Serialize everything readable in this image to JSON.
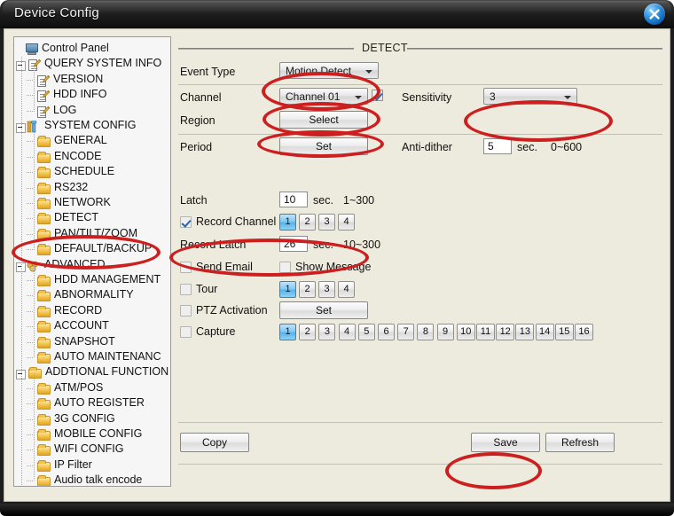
{
  "window": {
    "title": "Device Config",
    "close_icon": "close-x-icon"
  },
  "tree": {
    "items": [
      {
        "label": "Control Panel",
        "icon": "monitor-icon",
        "depth": 0,
        "expander": false
      },
      {
        "label": "QUERY SYSTEM INFO",
        "icon": "document-pencil-icon",
        "depth": 0,
        "expander": true
      },
      {
        "label": "VERSION",
        "icon": "document-pencil-icon",
        "depth": 1,
        "expander": false
      },
      {
        "label": "HDD INFO",
        "icon": "document-pencil-icon",
        "depth": 1,
        "expander": false
      },
      {
        "label": "LOG",
        "icon": "document-pencil-icon",
        "depth": 1,
        "expander": false
      },
      {
        "label": "SYSTEM CONFIG",
        "icon": "tool-icon",
        "depth": 0,
        "expander": true
      },
      {
        "label": "GENERAL",
        "icon": "folder-icon",
        "depth": 1,
        "expander": false
      },
      {
        "label": "ENCODE",
        "icon": "folder-icon",
        "depth": 1,
        "expander": false
      },
      {
        "label": "SCHEDULE",
        "icon": "folder-icon",
        "depth": 1,
        "expander": false
      },
      {
        "label": "RS232",
        "icon": "folder-icon",
        "depth": 1,
        "expander": false
      },
      {
        "label": "NETWORK",
        "icon": "folder-icon",
        "depth": 1,
        "expander": false
      },
      {
        "label": "DETECT",
        "icon": "folder-icon",
        "depth": 1,
        "expander": false
      },
      {
        "label": "PAN/TILT/ZOOM",
        "icon": "folder-icon",
        "depth": 1,
        "expander": false
      },
      {
        "label": "DEFAULT/BACKUP",
        "icon": "folder-icon",
        "depth": 1,
        "expander": false
      },
      {
        "label": "ADVANCED",
        "icon": "advanced-icon",
        "depth": 0,
        "expander": true
      },
      {
        "label": "HDD MANAGEMENT",
        "icon": "folder-icon",
        "depth": 1,
        "expander": false
      },
      {
        "label": "ABNORMALITY",
        "icon": "folder-icon",
        "depth": 1,
        "expander": false
      },
      {
        "label": "RECORD",
        "icon": "folder-icon",
        "depth": 1,
        "expander": false
      },
      {
        "label": "ACCOUNT",
        "icon": "folder-icon",
        "depth": 1,
        "expander": false
      },
      {
        "label": "SNAPSHOT",
        "icon": "folder-icon",
        "depth": 1,
        "expander": false
      },
      {
        "label": "AUTO MAINTENANC",
        "icon": "folder-icon",
        "depth": 1,
        "expander": false
      },
      {
        "label": "ADDTIONAL FUNCTION",
        "icon": "folder-icon",
        "depth": 0,
        "expander": true
      },
      {
        "label": "ATM/POS",
        "icon": "folder-icon",
        "depth": 1,
        "expander": false
      },
      {
        "label": "AUTO REGISTER",
        "icon": "folder-icon",
        "depth": 1,
        "expander": false
      },
      {
        "label": "3G CONFIG",
        "icon": "folder-icon",
        "depth": 1,
        "expander": false
      },
      {
        "label": "MOBILE CONFIG",
        "icon": "folder-icon",
        "depth": 1,
        "expander": false
      },
      {
        "label": "WIFI CONFIG",
        "icon": "folder-icon",
        "depth": 1,
        "expander": false
      },
      {
        "label": "IP Filter",
        "icon": "folder-icon",
        "depth": 1,
        "expander": false
      },
      {
        "label": "Audio talk encode",
        "icon": "folder-icon",
        "depth": 1,
        "expander": false
      }
    ]
  },
  "panel": {
    "header": "DETECT",
    "event_type": {
      "label": "Event Type",
      "value": "Motion Detect"
    },
    "channel": {
      "label": "Channel",
      "value": "Channel 01",
      "enabled_checked": true
    },
    "sensitivity": {
      "label": "Sensitivity",
      "value": "3"
    },
    "region": {
      "label": "Region",
      "button": "Select"
    },
    "period": {
      "label": "Period",
      "button": "Set"
    },
    "anti_dither": {
      "label": "Anti-dither",
      "value": "5",
      "unit": "sec.",
      "range": "0~600"
    },
    "latch": {
      "label": "Latch",
      "value": "10",
      "unit": "sec.",
      "range": "1~300"
    },
    "record_channel": {
      "label": "Record Channel",
      "checked": true,
      "buttons": [
        "1",
        "2",
        "3",
        "4"
      ],
      "active": "1"
    },
    "record_latch": {
      "label": "Record Latch",
      "value": "26",
      "unit": "sec.",
      "range": "10~300"
    },
    "send_email": {
      "label": "Send Email",
      "checked": false
    },
    "show_message": {
      "label": "Show Message",
      "checked": false
    },
    "tour": {
      "label": "Tour",
      "checked": false,
      "buttons": [
        "1",
        "2",
        "3",
        "4"
      ],
      "active": "1"
    },
    "ptz_activation": {
      "label": "PTZ Activation",
      "checked": false,
      "button": "Set"
    },
    "capture": {
      "label": "Capture",
      "checked": false,
      "buttons": [
        "1",
        "2",
        "3",
        "4",
        "5",
        "6",
        "7",
        "8",
        "9",
        "10",
        "11",
        "12",
        "13",
        "14",
        "15",
        "16"
      ],
      "active": "1"
    },
    "footer": {
      "copy": "Copy",
      "save": "Save",
      "refresh": "Refresh"
    }
  },
  "annotations": {
    "accent_color": "#cc1f1f",
    "highlights": [
      "event-type-dropdown",
      "channel-dropdown",
      "sensitivity-dropdown",
      "region-select-button",
      "record-channel-row",
      "detect-tree-item",
      "save-button"
    ]
  }
}
